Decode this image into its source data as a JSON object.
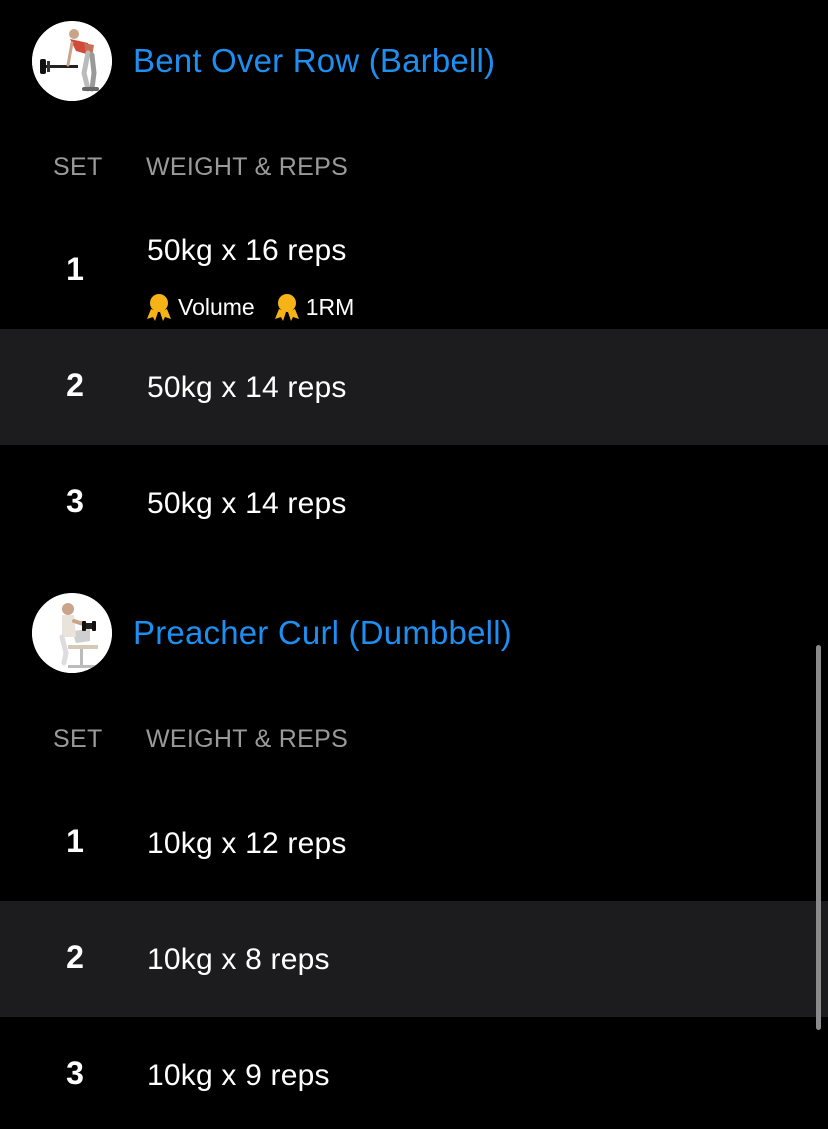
{
  "exercises": [
    {
      "title": "Bent Over Row (Barbell)",
      "thumbnail_icon": "barbell-row-illustration-icon",
      "columns": {
        "set": "SET",
        "weight_reps": "WEIGHT & REPS"
      },
      "sets": [
        {
          "num": "1",
          "detail": "50kg x 16 reps",
          "badges": [
            "Volume",
            "1RM"
          ]
        },
        {
          "num": "2",
          "detail": "50kg x 14 reps"
        },
        {
          "num": "3",
          "detail": "50kg x 14 reps"
        }
      ]
    },
    {
      "title": "Preacher Curl (Dumbbell)",
      "thumbnail_icon": "preacher-curl-illustration-icon",
      "columns": {
        "set": "SET",
        "weight_reps": "WEIGHT & REPS"
      },
      "sets": [
        {
          "num": "1",
          "detail": "10kg x 12 reps"
        },
        {
          "num": "2",
          "detail": "10kg x 8 reps"
        },
        {
          "num": "3",
          "detail": "10kg x 9 reps"
        }
      ]
    }
  ],
  "colors": {
    "background": "#000000",
    "accent": "#1e8ef0",
    "alt_row": "#1c1c1e",
    "muted": "#9a9a9a",
    "medal": "#f6b318"
  }
}
